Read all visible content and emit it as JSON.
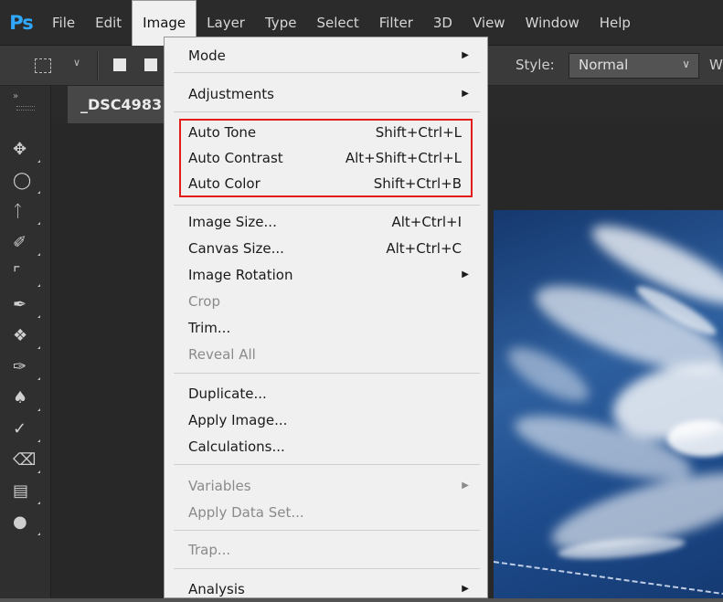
{
  "app": {
    "logo_text": "Ps"
  },
  "menubar": [
    {
      "id": "file",
      "label": "File"
    },
    {
      "id": "edit",
      "label": "Edit"
    },
    {
      "id": "image",
      "label": "Image"
    },
    {
      "id": "layer",
      "label": "Layer"
    },
    {
      "id": "type",
      "label": "Type"
    },
    {
      "id": "select",
      "label": "Select"
    },
    {
      "id": "filter",
      "label": "Filter"
    },
    {
      "id": "3d",
      "label": "3D"
    },
    {
      "id": "view",
      "label": "View"
    },
    {
      "id": "window",
      "label": "Window"
    },
    {
      "id": "help",
      "label": "Help"
    }
  ],
  "options_bar": {
    "style_label": "Style:",
    "style_value": "Normal",
    "width_label_fragment": "W"
  },
  "document": {
    "tab_title": "_DSC4983"
  },
  "image_menu": {
    "mode": "Mode",
    "adjustments": "Adjustments",
    "auto_tone": {
      "label": "Auto Tone",
      "shortcut": "Shift+Ctrl+L"
    },
    "auto_contrast": {
      "label": "Auto Contrast",
      "shortcut": "Alt+Shift+Ctrl+L"
    },
    "auto_color": {
      "label": "Auto Color",
      "shortcut": "Shift+Ctrl+B"
    },
    "image_size": {
      "label": "Image Size...",
      "shortcut": "Alt+Ctrl+I"
    },
    "canvas_size": {
      "label": "Canvas Size...",
      "shortcut": "Alt+Ctrl+C"
    },
    "image_rotation": "Image Rotation",
    "crop": "Crop",
    "trim": "Trim...",
    "reveal_all": "Reveal All",
    "duplicate": "Duplicate...",
    "apply_image": "Apply Image...",
    "calculations": "Calculations...",
    "variables": "Variables",
    "apply_data_set": "Apply Data Set...",
    "trap": "Trap...",
    "analysis": "Analysis"
  },
  "colors": {
    "highlight_box": "#e21b1b",
    "menu_background": "#f0f0f0",
    "ps_logo": "#31a8ff"
  }
}
